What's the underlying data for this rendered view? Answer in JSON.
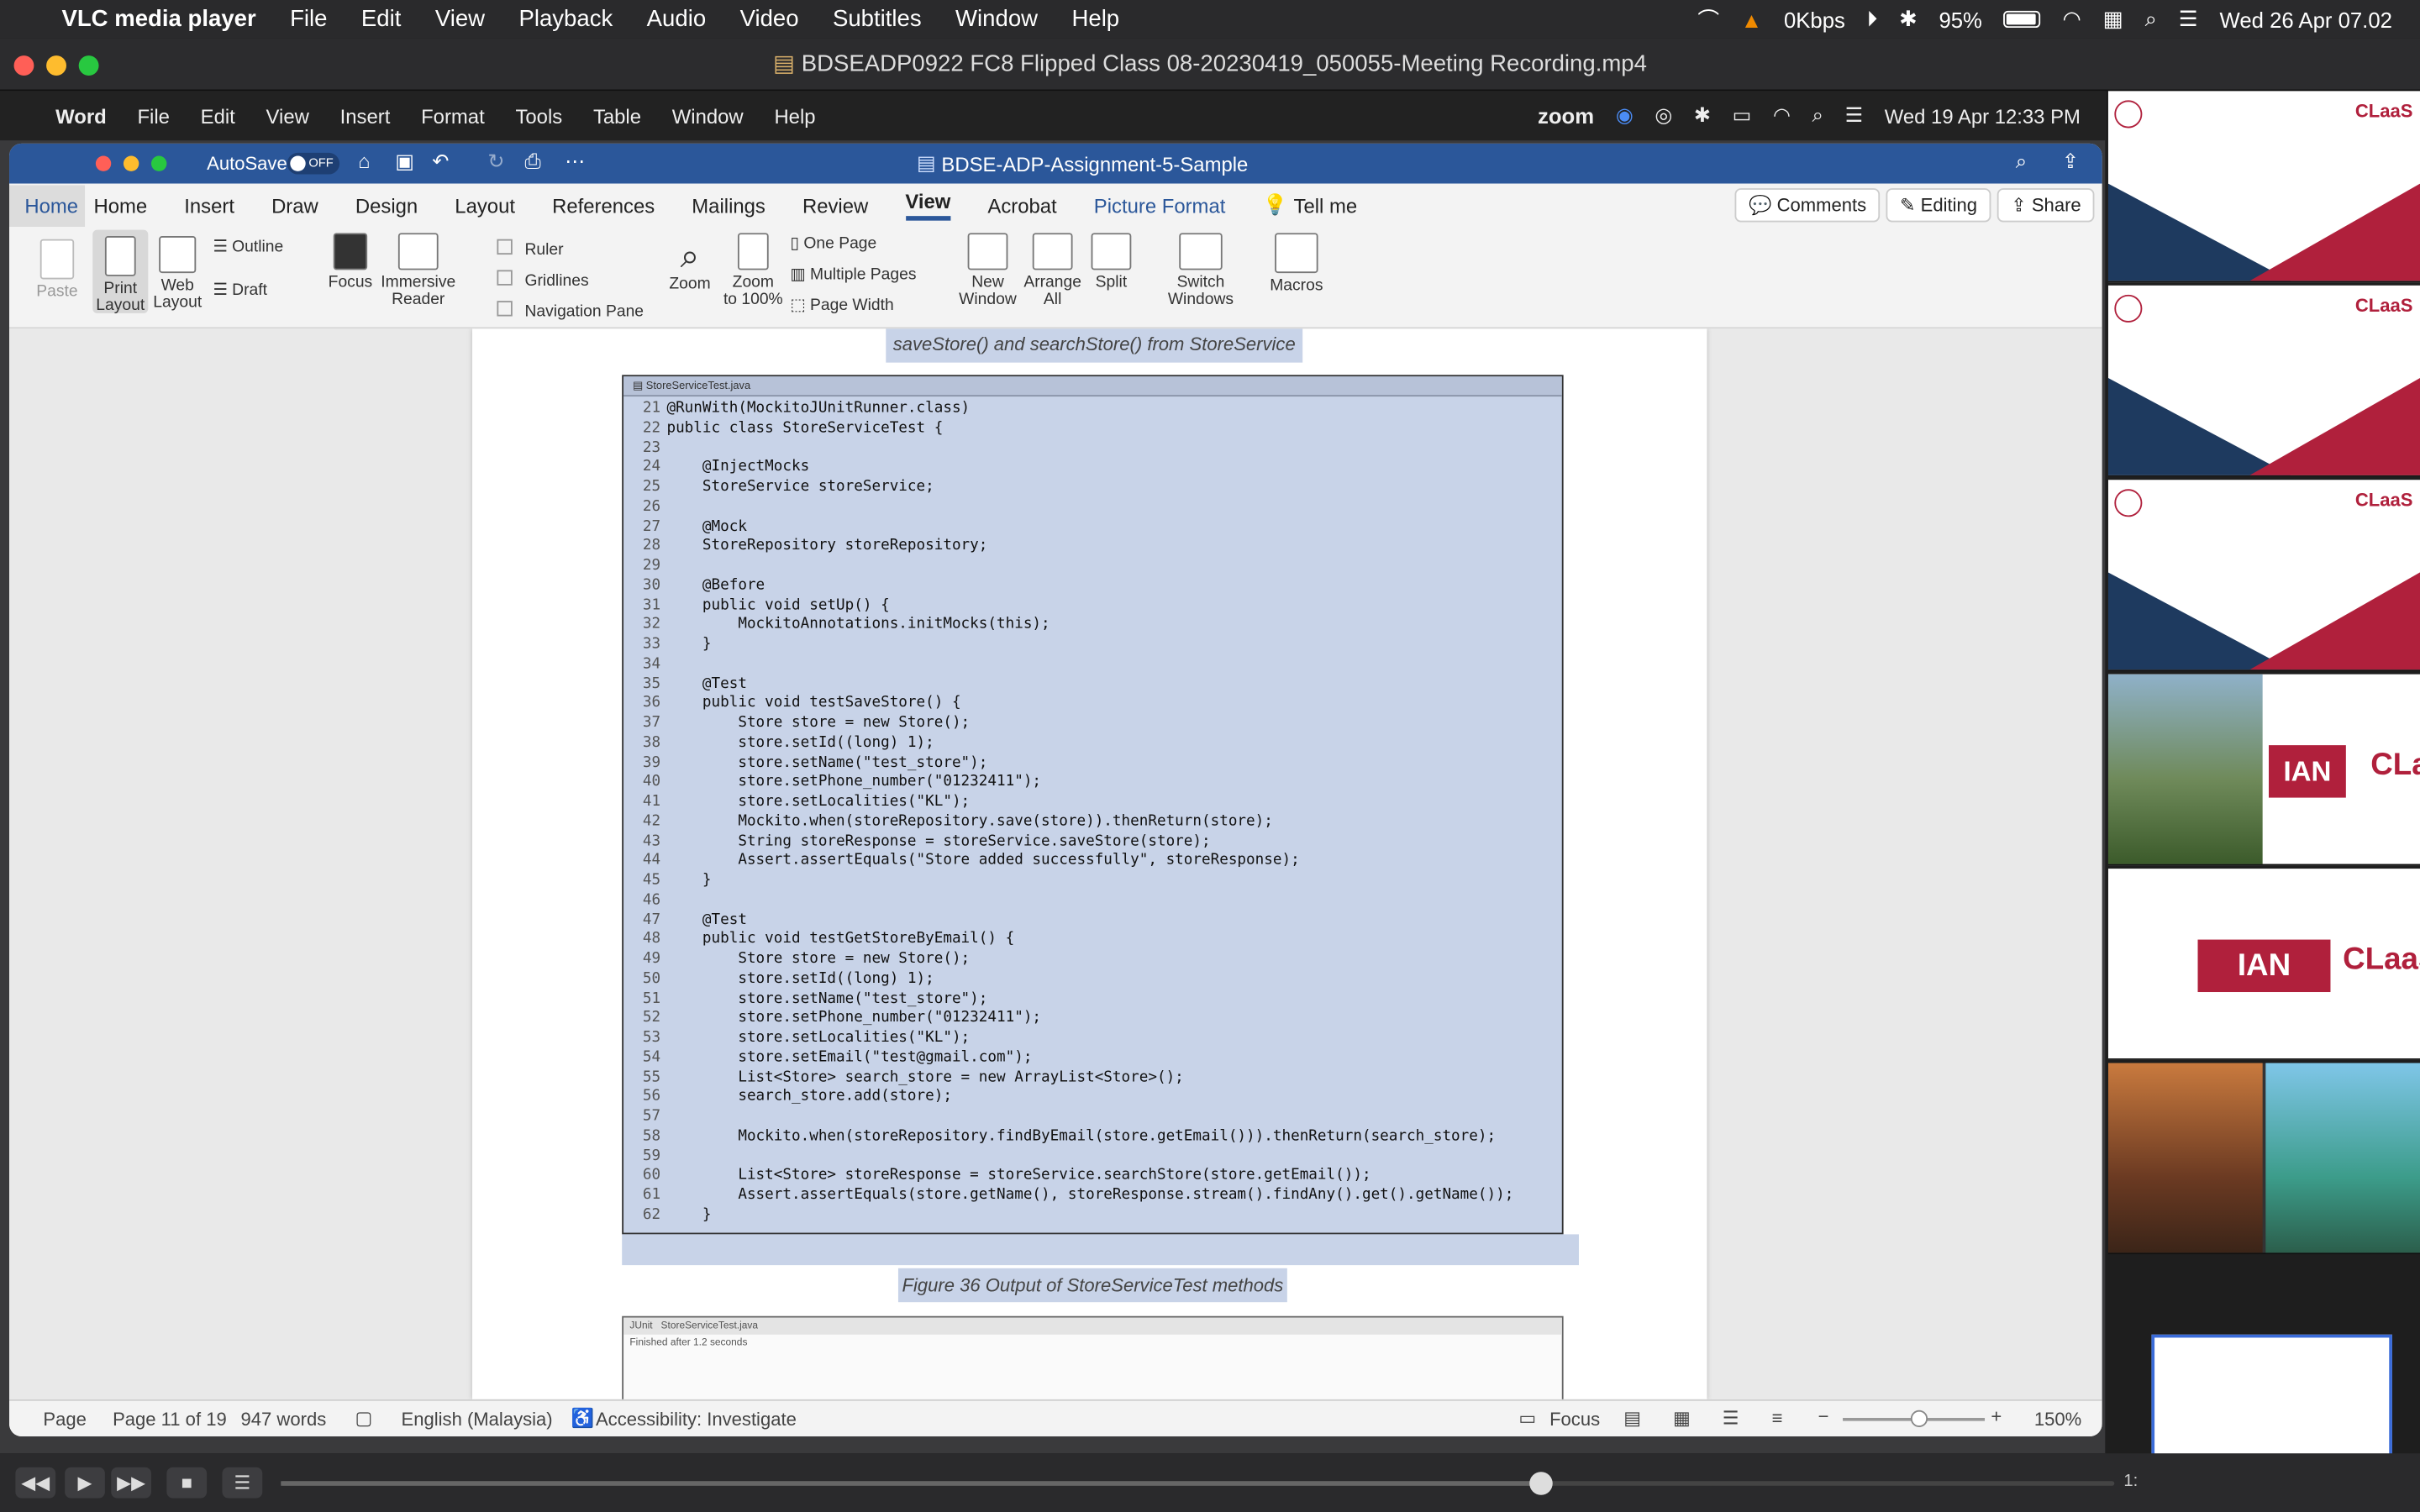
{
  "menubar": {
    "app": "VLC media player",
    "items": [
      "File",
      "Edit",
      "View",
      "Playback",
      "Audio",
      "Video",
      "Subtitles",
      "Window",
      "Help"
    ],
    "net": "0Kbps",
    "battery": "95%",
    "clock": "Wed 26 Apr 07.02"
  },
  "vlc": {
    "title": "BDSEADP0922  FC8  Flipped Class 08-20230419_050055-Meeting Recording.mp4",
    "time_right": "1:"
  },
  "inner_menubar": {
    "app": "Word",
    "items": [
      "File",
      "Edit",
      "View",
      "Insert",
      "Format",
      "Tools",
      "Table",
      "Window",
      "Help"
    ],
    "zoom_label": "zoom",
    "clock": "Wed 19 Apr  12:33 PM"
  },
  "word": {
    "autosave": "AutoSave",
    "toggle": "OFF",
    "doc_title": "BDSE-ADP-Assignment-5-Sample",
    "tabs": [
      "Home",
      "Insert",
      "Draw",
      "Design",
      "Layout",
      "References",
      "Mailings",
      "Review",
      "View",
      "Acrobat",
      "Picture Format",
      "Tell me"
    ],
    "home_side": "Home",
    "comments": "Comments",
    "editing": "Editing",
    "share": "Share",
    "ribbon": {
      "paste": "Paste",
      "print_layout": "Print\nLayout",
      "web_layout": "Web\nLayout",
      "outline": "Outline",
      "draft": "Draft",
      "focus": "Focus",
      "immersive": "Immersive\nReader",
      "ruler": "Ruler",
      "gridlines": "Gridlines",
      "nav_pane": "Navigation Pane",
      "zoom": "Zoom",
      "zoom100": "Zoom\nto 100%",
      "one_page": "One Page",
      "multi_pages": "Multiple Pages",
      "page_width": "Page Width",
      "new_window": "New\nWindow",
      "arrange_all": "Arrange\nAll",
      "split": "Split",
      "switch_windows": "Switch\nWindows",
      "macros": "Macros"
    },
    "caption_top": "saveStore() and searchStore() from StoreService",
    "code_tab": "StoreServiceTest.java",
    "code": [
      {
        "n": "21",
        "t": "@RunWith(MockitoJUnitRunner.class)"
      },
      {
        "n": "22",
        "t": "public class StoreServiceTest {"
      },
      {
        "n": "23",
        "t": ""
      },
      {
        "n": "24",
        "t": "    @InjectMocks"
      },
      {
        "n": "25",
        "t": "    StoreService storeService;"
      },
      {
        "n": "26",
        "t": ""
      },
      {
        "n": "27",
        "t": "    @Mock"
      },
      {
        "n": "28",
        "t": "    StoreRepository storeRepository;"
      },
      {
        "n": "29",
        "t": ""
      },
      {
        "n": "30",
        "t": "    @Before"
      },
      {
        "n": "31",
        "t": "    public void setUp() {"
      },
      {
        "n": "32",
        "t": "        MockitoAnnotations.initMocks(this);"
      },
      {
        "n": "33",
        "t": "    }"
      },
      {
        "n": "34",
        "t": ""
      },
      {
        "n": "35",
        "t": "    @Test"
      },
      {
        "n": "36",
        "t": "    public void testSaveStore() {"
      },
      {
        "n": "37",
        "t": "        Store store = new Store();"
      },
      {
        "n": "38",
        "t": "        store.setId((long) 1);"
      },
      {
        "n": "39",
        "t": "        store.setName(\"test_store\");"
      },
      {
        "n": "40",
        "t": "        store.setPhone_number(\"01232411\");"
      },
      {
        "n": "41",
        "t": "        store.setLocalities(\"KL\");"
      },
      {
        "n": "42",
        "t": "        Mockito.when(storeRepository.save(store)).thenReturn(store);"
      },
      {
        "n": "43",
        "t": "        String storeResponse = storeService.saveStore(store);"
      },
      {
        "n": "44",
        "t": "        Assert.assertEquals(\"Store added successfully\", storeResponse);"
      },
      {
        "n": "45",
        "t": "    }"
      },
      {
        "n": "46",
        "t": ""
      },
      {
        "n": "47",
        "t": "    @Test"
      },
      {
        "n": "48",
        "t": "    public void testGetStoreByEmail() {"
      },
      {
        "n": "49",
        "t": "        Store store = new Store();"
      },
      {
        "n": "50",
        "t": "        store.setId((long) 1);"
      },
      {
        "n": "51",
        "t": "        store.setName(\"test_store\");"
      },
      {
        "n": "52",
        "t": "        store.setPhone_number(\"01232411\");"
      },
      {
        "n": "53",
        "t": "        store.setLocalities(\"KL\");"
      },
      {
        "n": "54",
        "t": "        store.setEmail(\"test@gmail.com\");"
      },
      {
        "n": "55",
        "t": "        List<Store> search_store = new ArrayList<Store>();"
      },
      {
        "n": "56",
        "t": "        search_store.add(store);"
      },
      {
        "n": "57",
        "t": ""
      },
      {
        "n": "58",
        "t": "        Mockito.when(storeRepository.findByEmail(store.getEmail())).thenReturn(search_store);"
      },
      {
        "n": "59",
        "t": ""
      },
      {
        "n": "60",
        "t": "        List<Store> storeResponse = storeService.searchStore(store.getEmail());"
      },
      {
        "n": "61",
        "t": "        Assert.assertEquals(store.getName(), storeResponse.stream().findAny().get().getName());"
      },
      {
        "n": "62",
        "t": "    }"
      }
    ],
    "caption_bottom": "Figure 36 Output of StoreServiceTest methods",
    "junit_tab1": "JUnit",
    "junit_tab2": "StoreServiceTest.java",
    "junit_line": "Finished after 1.2 seconds",
    "status": {
      "page_label": "Page",
      "page": "Page 11 of 19",
      "words": "947 words",
      "lang": "English (Malaysia)",
      "access": "Accessibility: Investigate",
      "focus": "Focus",
      "zoom": "150%"
    }
  },
  "sidebar": {
    "brand": "CLaaS",
    "mid_text": "IAN"
  },
  "colors": {
    "word_blue": "#2b579a",
    "selection": "#c8d3e8",
    "vlc_orange": "#f08a00",
    "brand_red": "#b0203c"
  }
}
